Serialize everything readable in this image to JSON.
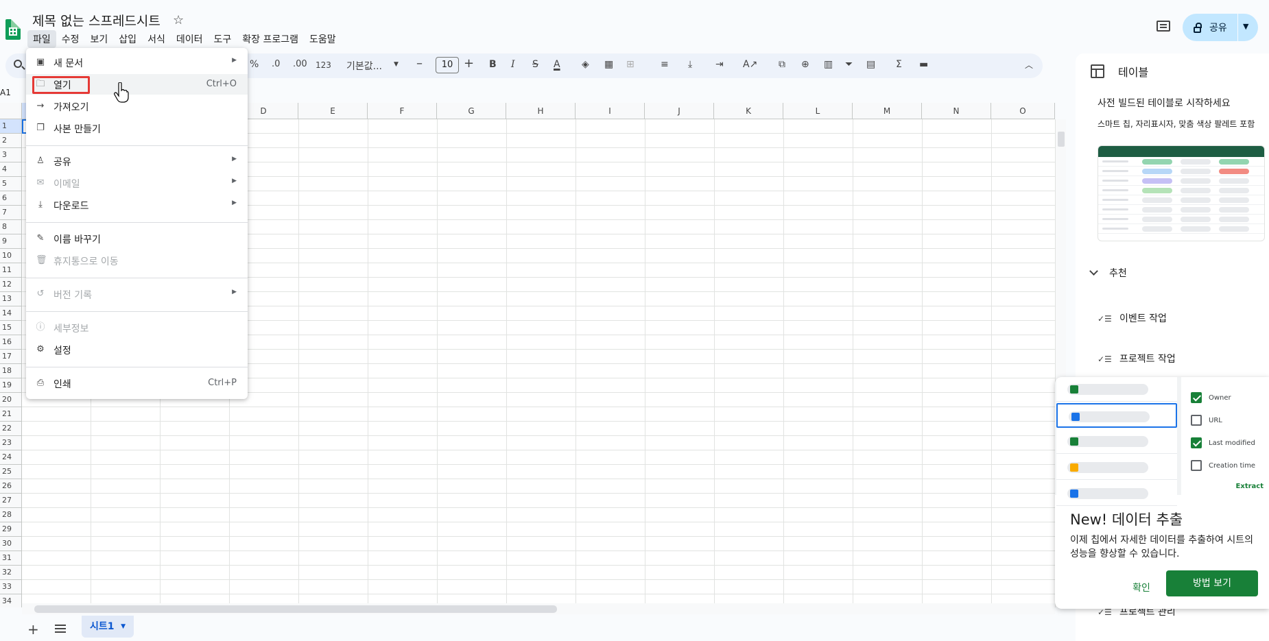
{
  "app": {
    "title": "제목 없는 스프레드시트",
    "share_label": "공유"
  },
  "menubar": [
    "파일",
    "수정",
    "보기",
    "삽입",
    "서식",
    "데이터",
    "도구",
    "확장 프로그램",
    "도움말"
  ],
  "toolbar": {
    "percent": "%",
    "dec_less": ".0",
    "dec_more": ".00",
    "number_format": "123",
    "font": "기본값...",
    "font_size": "10",
    "bold": "B",
    "italic": "I",
    "strike": "S",
    "text_color": "A",
    "sum": "Σ"
  },
  "namebox": "A1",
  "columns": [
    "D",
    "E",
    "F",
    "G",
    "H",
    "I",
    "J",
    "K",
    "L",
    "M",
    "N",
    "O"
  ],
  "rows": [
    "1",
    "2",
    "3",
    "4",
    "5",
    "6",
    "7",
    "8",
    "9",
    "10",
    "11",
    "12",
    "13",
    "14",
    "15",
    "16",
    "17",
    "18",
    "19",
    "20",
    "21",
    "22",
    "23",
    "24",
    "25",
    "26",
    "27",
    "28",
    "29",
    "30",
    "31",
    "32",
    "33",
    "34"
  ],
  "sheet_tab": "시트1",
  "file_menu": {
    "new": "새 문서",
    "open": "열기",
    "open_shortcut": "Ctrl+O",
    "import": "가져오기",
    "copy": "사본 만들기",
    "share": "공유",
    "email": "이메일",
    "download": "다운로드",
    "rename": "이름 바꾸기",
    "trash": "휴지통으로 이동",
    "version": "버전 기록",
    "details": "세부정보",
    "settings": "설정",
    "print": "인쇄",
    "print_shortcut": "Ctrl+P"
  },
  "side_panel": {
    "title": "테이블",
    "subtitle": "사전 빌드된 테이블로 시작하세요",
    "desc": "스마트 칩, 자리표시자, 맞춤 색상 팔레트 포함",
    "section": "추천",
    "items": [
      "이벤트 작업",
      "프로젝트 작업",
      "프로젝트 관리"
    ]
  },
  "promo": {
    "title": "New! 데이터 추출",
    "body": "이제 칩에서 자세한 데이터를 추출하여 시트의 성능을 향상할 수 있습니다.",
    "ok": "확인",
    "how": "방법 보기",
    "options": [
      {
        "label": "Owner",
        "checked": true
      },
      {
        "label": "URL",
        "checked": false
      },
      {
        "label": "Last modified",
        "checked": true
      },
      {
        "label": "Creation time",
        "checked": false
      }
    ],
    "extract": "Extract"
  },
  "colors": {
    "accent_green": "#188038",
    "share_bg": "#c2e7ff",
    "highlight": "#e53935"
  }
}
